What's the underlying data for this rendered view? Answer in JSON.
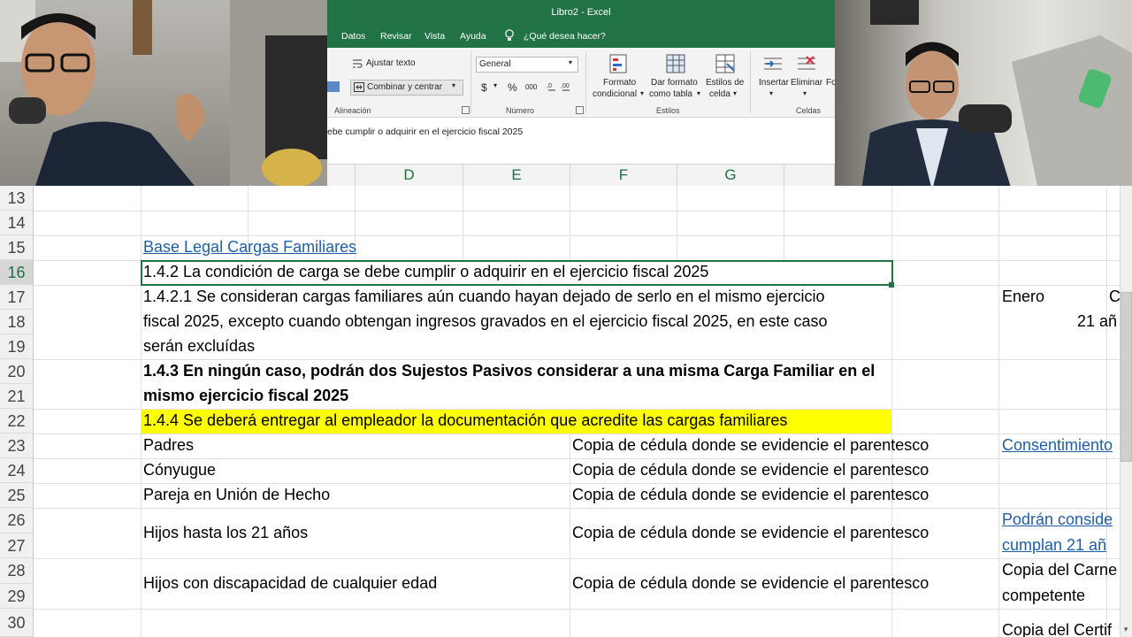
{
  "window": {
    "title": "Libro2  -  Excel"
  },
  "menu_tabs": [
    "Datos",
    "Revisar",
    "Vista",
    "Ayuda"
  ],
  "tell_me": "¿Qué desea hacer?",
  "ribbon": {
    "wrap_text": "Ajustar texto",
    "merge_center": "Combinar y centrar",
    "alignment_group": "Alineación",
    "number_format": "General",
    "currency": "$",
    "percent": "%",
    "thousands": "000",
    "number_group": "Número",
    "conditional_format_l1": "Formato",
    "conditional_format_l2": "condicional",
    "format_table_l1": "Dar formato",
    "format_table_l2": "como tabla",
    "cell_styles_l1": "Estilos de",
    "cell_styles_l2": "celda",
    "styles_group": "Estilos",
    "insert": "Insertar",
    "delete": "Eliminar",
    "format_cut": "Fo",
    "cells_group": "Celdas"
  },
  "formula_bar": {
    "text": "ebe cumplir o adquirir en el ejercicio fiscal 2025"
  },
  "columns": [
    "D",
    "E",
    "F",
    "G"
  ],
  "rows": [
    "13",
    "14",
    "15",
    "16",
    "17",
    "18",
    "19",
    "20",
    "21",
    "22",
    "23",
    "24",
    "25",
    "26",
    "27",
    "28",
    "29",
    "30"
  ],
  "cells": {
    "r15": "Base Legal Cargas Familiares",
    "r16": "1.4.2 La condición de carga se debe cumplir o adquirir en el ejercicio fiscal 2025",
    "r17": "1.4.2.1 Se consideran cargas familiares aún cuando hayan dejado de serlo en el mismo ejercicio",
    "r18": "fiscal 2025, excepto cuando obtengan ingresos gravados en el ejercicio fiscal 2025, en este caso",
    "r19": "serán excluídas",
    "r20": "1.4.3 En ningún caso, podrán dos Sujestos Pasivos considerar a una misma Carga Familiar en el",
    "r21": "mismo ejercicio fiscal 2025",
    "r22": "1.4.4 Se deberá entregar al empleador la documentación que acredite las cargas familiares",
    "r23b": "Padres",
    "r24b": "Cónyugue",
    "r25b": "Pareja en Unión de Hecho",
    "r26b": "Hijos hasta los 21 años",
    "r28b": "Hijos con discapacidad de cualquier edad",
    "doc": "Copia de cédula donde se evidencie el parentesco",
    "r17j": "Enero",
    "r17k": "C",
    "r18j": "21 añ",
    "r23j": "Consentimiento",
    "r26j": "Podrán conside",
    "r27j": "cumplan 21 añ",
    "r28j": "Copia del Carne",
    "r29j": "competente",
    "r30j": "Copia del Certif"
  }
}
